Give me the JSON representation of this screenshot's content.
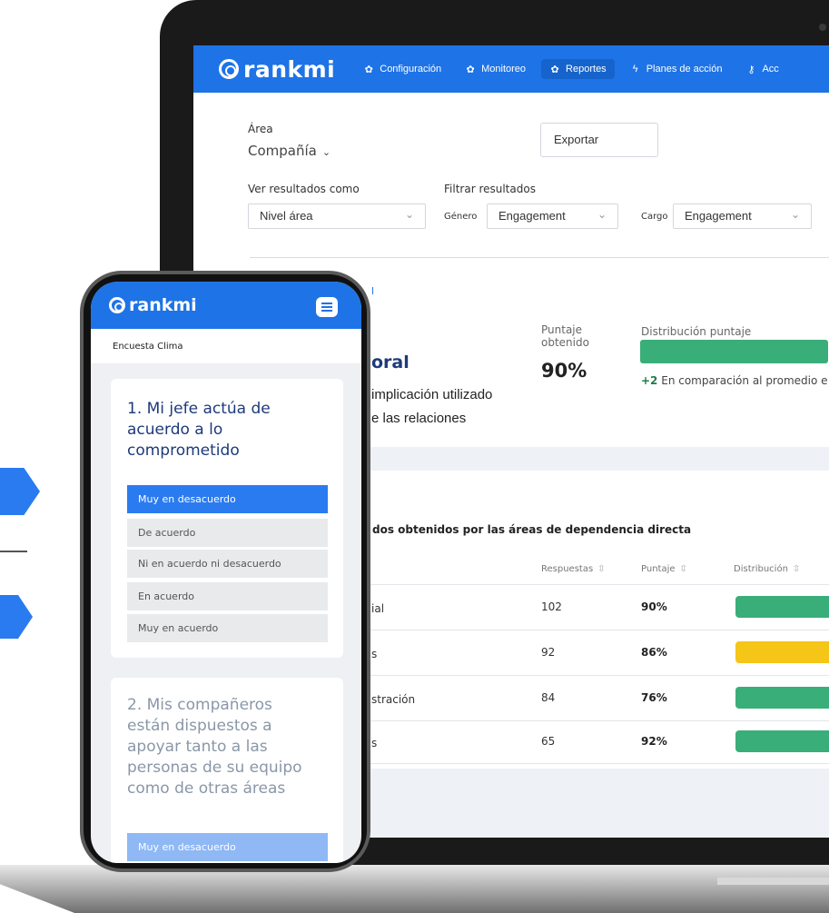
{
  "colors": {
    "brand": "#1e73e6",
    "green": "#3aae78",
    "amber": "#f5c518",
    "navy": "#1d3a7a"
  },
  "laptop": {
    "brand": "rankmi",
    "nav": [
      {
        "label": "Configuración",
        "icon": "gear-icon",
        "active": false
      },
      {
        "label": "Monitoreo",
        "icon": "gear-icon",
        "active": false
      },
      {
        "label": "Reportes",
        "icon": "gear-icon",
        "active": true
      },
      {
        "label": "Planes de acción",
        "icon": "bolt-icon",
        "active": false
      },
      {
        "label": "Acc",
        "icon": "key-icon",
        "active": false
      }
    ],
    "area_label": "Área",
    "area_value": "Compañía",
    "export_label": "Exportar",
    "ver_label": "Ver resultados como",
    "ver_value": "Nivel área",
    "filtrar_label": "Filtrar resultados",
    "genero_label": "Género",
    "genero_value": "Engagement",
    "cargo_label": "Cargo",
    "cargo_value": "Engagement",
    "card": {
      "link_fragment": "l",
      "title_fragment": "oral",
      "text1": "implicación utilizado",
      "text2": "e las relaciones",
      "score_label_1": "Puntaje",
      "score_label_2": "obtenido",
      "score_value": "90%",
      "score_fraction": 0.9,
      "dist_label": "Distribución puntaje",
      "comparison_delta": "+2",
      "comparison_text": "En comparación al promedio e"
    },
    "table": {
      "title": "dos obtenidos por las áreas de dependencia directa",
      "headers": {
        "respuestas": "Respuestas",
        "puntaje": "Puntaje",
        "distribucion": "Distribución"
      },
      "rows": [
        {
          "name": "ial",
          "respuestas": "102",
          "puntaje": "90%",
          "status": "green"
        },
        {
          "name": "s",
          "respuestas": "92",
          "puntaje": "86%",
          "status": "amber"
        },
        {
          "name": "stración",
          "respuestas": "84",
          "puntaje": "76%",
          "status": "green"
        },
        {
          "name": "s",
          "respuestas": "65",
          "puntaje": "92%",
          "status": "green"
        }
      ]
    }
  },
  "phone": {
    "brand": "rankmi",
    "survey_label": "Encuesta Clima",
    "q1": {
      "lines": [
        "1. Mi jefe actúa de",
        "acuerdo a lo",
        "comprometido"
      ],
      "options": [
        "Muy en desacuerdo",
        "De acuerdo",
        "Ni en acuerdo ni desacuerdo",
        "En acuerdo",
        "Muy en acuerdo"
      ],
      "selected": "Muy en desacuerdo"
    },
    "q2": {
      "lines": [
        "2. Mis compañeros",
        "están dispuestos a",
        "apoyar tanto a las",
        "personas de su equipo",
        "como de otras áreas"
      ],
      "first_option": "Muy en desacuerdo"
    }
  }
}
